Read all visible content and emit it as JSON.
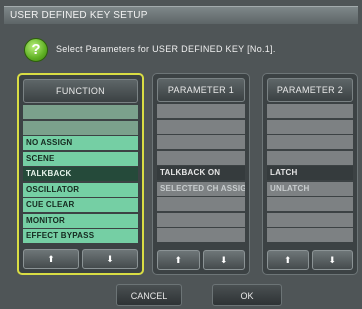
{
  "window": {
    "title": "USER DEFINED KEY SETUP"
  },
  "help": {
    "glyph": "?"
  },
  "instruction": "Select Parameters for USER DEFINED KEY [No.1].",
  "columns": {
    "function": {
      "header": "FUNCTION",
      "rows": [
        "",
        "",
        "NO ASSIGN",
        "SCENE",
        "TALKBACK",
        "OSCILLATOR",
        "CUE CLEAR",
        "MONITOR",
        "EFFECT BYPASS"
      ],
      "selected_index": 4
    },
    "parameter1": {
      "header": "PARAMETER 1",
      "rows": [
        "",
        "",
        "",
        "",
        "TALKBACK ON",
        "SELECTED CH ASSIGN",
        "",
        "",
        ""
      ],
      "selected_index": 4
    },
    "parameter2": {
      "header": "PARAMETER 2",
      "rows": [
        "",
        "",
        "",
        "",
        "LATCH",
        "UNLATCH",
        "",
        "",
        ""
      ],
      "selected_index": 4
    }
  },
  "arrows": {
    "up": "⬆",
    "down": "⬇"
  },
  "buttons": {
    "cancel": "CANCEL",
    "ok": "OK"
  },
  "colors": {
    "accent_border": "#d9dd44",
    "list_item": "#75cfa4",
    "list_selected": "#254a3a",
    "help_icon": "#5fb023"
  }
}
